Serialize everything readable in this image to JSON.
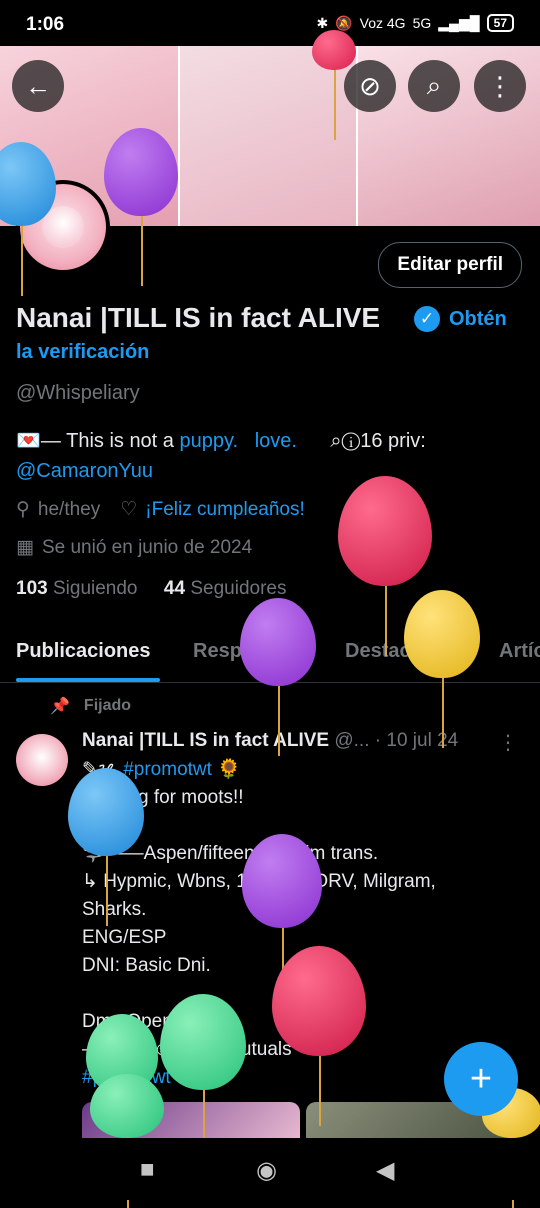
{
  "status": {
    "time": "1:06",
    "network": "Voz 4G",
    "signal": "5G",
    "battery": "57"
  },
  "header": {
    "back_icon": "arrow-left-icon",
    "icons": [
      "eye-slash-icon",
      "search-icon",
      "more-vertical-icon"
    ]
  },
  "profile": {
    "edit_label": "Editar perfil",
    "name": "Nanai |TILL IS in fact ALIVE",
    "verify_line1": "Obtén",
    "verify_line2": "la verificación",
    "handle": "@Whispeliary",
    "bio_prefix": "💌— This is not a ",
    "bio_link1": "puppy.",
    "bio_link2": "love.",
    "bio_suffix": "⌕ⓘ16  priv:",
    "bio_mention": "@CamaronYuu",
    "pronouns": "he/they",
    "birthday": "¡Feliz cumpleaños!",
    "joined": "Se unió en junio de 2024",
    "following_count": "103",
    "following_label": "Siguiendo",
    "followers_count": "44",
    "followers_label": "Seguidores"
  },
  "tabs": [
    "Publicaciones",
    "Respuestas",
    "Destacados",
    "Artíc"
  ],
  "post": {
    "pinned_label": "Fijado",
    "author": "Nanai |TILL IS in fact ALIVE",
    "handle_trunc": "@...",
    "date": "· 10 jul 24",
    "hashtag_prefix": "✎ᝰ",
    "hashtag": "#promotwt",
    "hashtag_emoji": "🌻",
    "lines": [
      "    Looking for moots!!",
      "",
      "🦈——Aspen/fifteen/ He/him trans.",
      "  ↳ Hypmic, Wbns, 19 days, ORV, Milgram,",
      "Sharks.",
      "ENG/ESP",
      "DNI: Basic Dni.",
      "",
      "Dms Open!!",
      "——♡ / ☺ to be mutuals"
    ],
    "last_hashtag": "#promotwt"
  },
  "colors": {
    "accent": "#1d9bf0",
    "muted": "#71767b",
    "text": "#e7e9ea",
    "background": "#000000"
  }
}
